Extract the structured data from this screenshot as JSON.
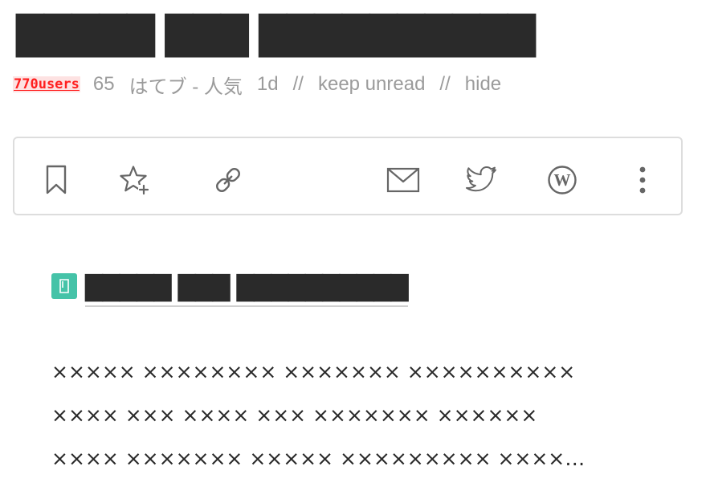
{
  "entry": {
    "title": "█████ ███ ██████████"
  },
  "meta": {
    "users": "770users",
    "count": "65",
    "category": "はてブ - 人気",
    "age": "1d",
    "separator": "//",
    "keep_unread": "keep unread",
    "hide": "hide"
  },
  "toolbar": {
    "icons": [
      "bookmark-icon",
      "star-plus-icon",
      "link-icon",
      "mail-icon",
      "twitter-icon",
      "wordpress-icon",
      "more-vertical-icon"
    ]
  },
  "card": {
    "favicon": "document-icon",
    "title": "█████ ███ ██████████",
    "excerpt": [
      "××××× ×××××××× ××××××× ××××××××××",
      "×××× ××× ×××× ××× ××××××× ××××××",
      "×××× ××××××× ××××× ××××××××× ××××…"
    ]
  },
  "colors": {
    "users_text": "#ff1f1f",
    "users_bg": "#fde2e2",
    "meta_text": "#9b9b9b",
    "icon": "#666666",
    "border": "#dddddd",
    "favicon_bg": "#45c3a8"
  }
}
